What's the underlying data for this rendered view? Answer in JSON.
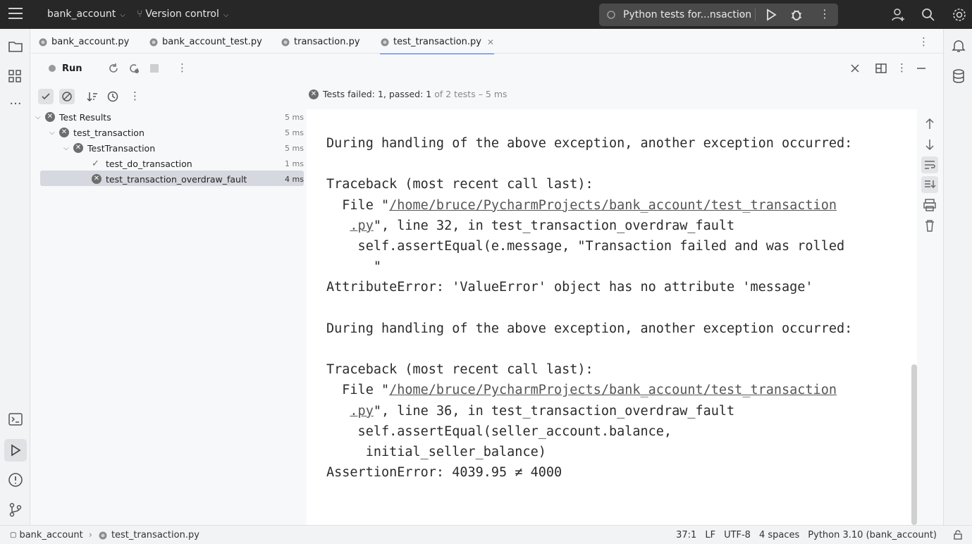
{
  "titlebar": {
    "project": "bank_account",
    "vcs": "Version control",
    "run_config": "Python tests for...nsaction"
  },
  "tabs": [
    {
      "label": "bank_account.py"
    },
    {
      "label": "bank_account_test.py"
    },
    {
      "label": "transaction.py"
    },
    {
      "label": "test_transaction.py",
      "active": true
    }
  ],
  "runbar": {
    "label": "Run"
  },
  "status": {
    "failed_label": "Tests failed:",
    "failed": "1",
    "passed_label": ", passed:",
    "passed": "1",
    "summary": "of 2 tests – 5 ms"
  },
  "tree": [
    {
      "label": "Test Results",
      "duration": "5 ms",
      "status": "failed"
    },
    {
      "label": "test_transaction",
      "duration": "5 ms",
      "status": "failed"
    },
    {
      "label": "TestTransaction",
      "duration": "5 ms",
      "status": "failed"
    },
    {
      "label": "test_do_transaction",
      "duration": "1 ms",
      "status": "passed"
    },
    {
      "label": "test_transaction_overdraw_fault",
      "duration": "4 ms",
      "status": "failed",
      "selected": true
    }
  ],
  "console": {
    "l1": "During handling of the above exception, another exception occurred:",
    "l2": "Traceback (most recent call last):",
    "l3a": "  File \"",
    "l3link": "/home/bruce/PycharmProjects/bank_account/test_transaction",
    "l4link": ".py",
    "l4b": "\", line 32, in test_transaction_overdraw_fault",
    "l5": "    self.assertEqual(e.message, \"Transaction failed and was rolled",
    "l6": "      \"",
    "l7": "AttributeError: 'ValueError' object has no attribute 'message'",
    "l8": "During handling of the above exception, another exception occurred:",
    "l9": "Traceback (most recent call last):",
    "l10a": "  File \"",
    "l10link": "/home/bruce/PycharmProjects/bank_account/test_transaction",
    "l11link": ".py",
    "l11b": "\", line 36, in test_transaction_overdraw_fault",
    "l12": "    self.assertEqual(seller_account.balance,",
    "l13": "     initial_seller_balance)",
    "l14": "AssertionError: 4039.95 ≠ 4000"
  },
  "statusbar": {
    "project": "bank_account",
    "file": "test_transaction.py",
    "position": "37:1",
    "line_sep": "LF",
    "encoding": "UTF-8",
    "indent": "4 spaces",
    "interpreter": "Python 3.10 (bank_account)"
  }
}
